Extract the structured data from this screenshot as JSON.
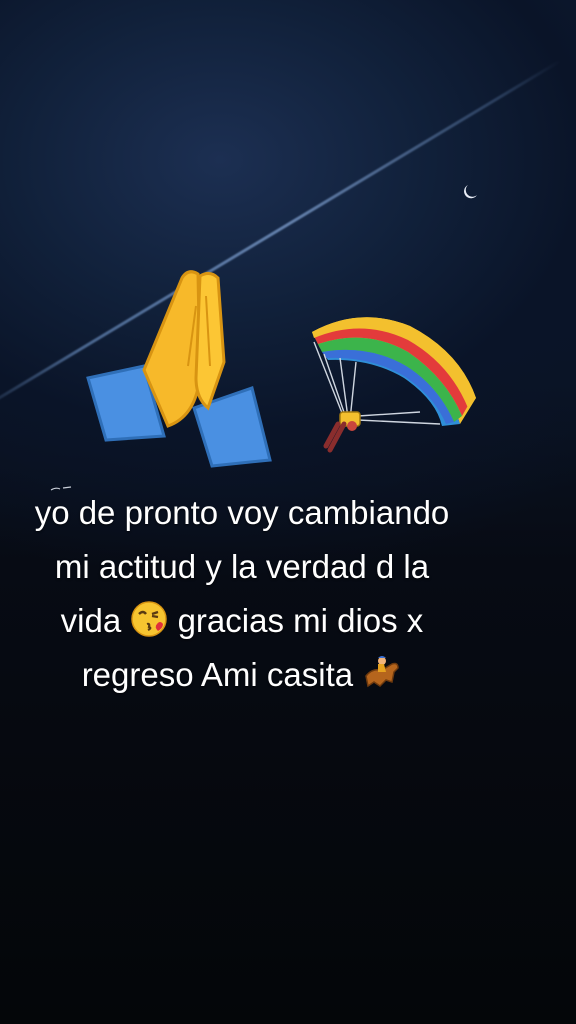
{
  "caption": {
    "line1": "yo de pronto voy cambiando",
    "line2": "mi actitud y la verdad d la",
    "line3_a": "vida",
    "line3_b": "gracias mi dios x",
    "line4": "regreso Ami casita"
  },
  "icons": {
    "prayer": "folded-hands-icon",
    "parachute": "parachute-icon",
    "kiss": "face-blowing-kiss-icon",
    "horse": "horse-racing-icon",
    "moon": "crescent-moon-icon"
  },
  "colors": {
    "background": "#05070d",
    "sky": "#11213b",
    "text": "#ffffff"
  }
}
